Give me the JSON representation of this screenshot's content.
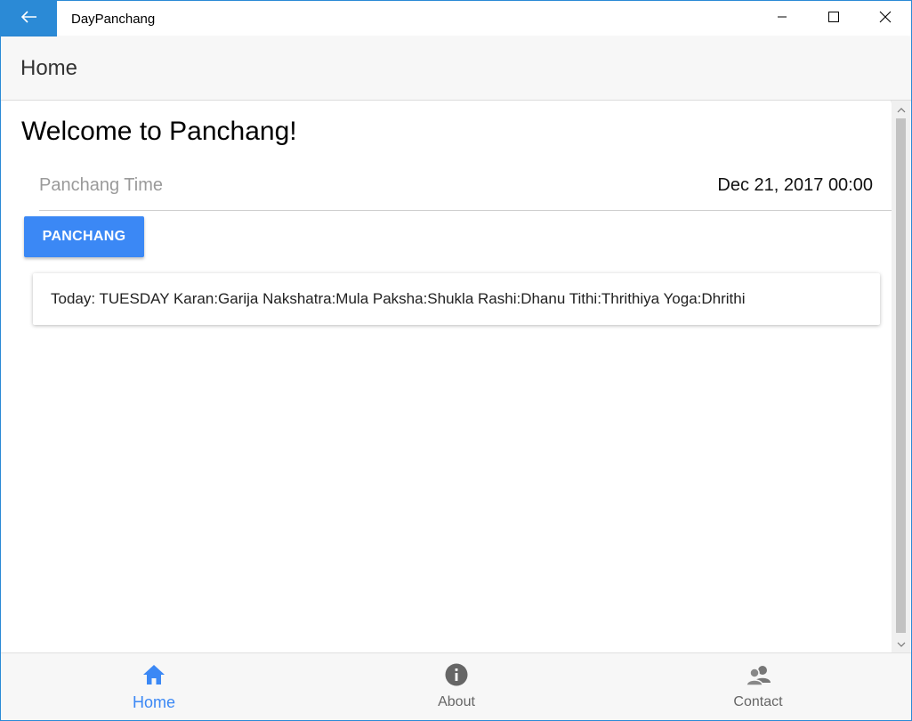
{
  "window": {
    "title": "DayPanchang"
  },
  "header": {
    "title": "Home"
  },
  "main": {
    "heading": "Welcome to Panchang!",
    "time_label": "Panchang Time",
    "time_value": "Dec 21, 2017 00:00",
    "button_label": "PANCHANG",
    "result_text": "Today: TUESDAY Karan:Garija Nakshatra:Mula Paksha:Shukla Rashi:Dhanu Tithi:Thrithiya Yoga:Dhrithi"
  },
  "bottom_nav": {
    "items": [
      {
        "label": "Home",
        "icon": "home-icon",
        "active": true
      },
      {
        "label": "About",
        "icon": "info-icon",
        "active": false
      },
      {
        "label": "Contact",
        "icon": "contacts-icon",
        "active": false
      }
    ]
  },
  "colors": {
    "accent": "#3b88f5",
    "titlebar_accent": "#2b8ad6"
  }
}
